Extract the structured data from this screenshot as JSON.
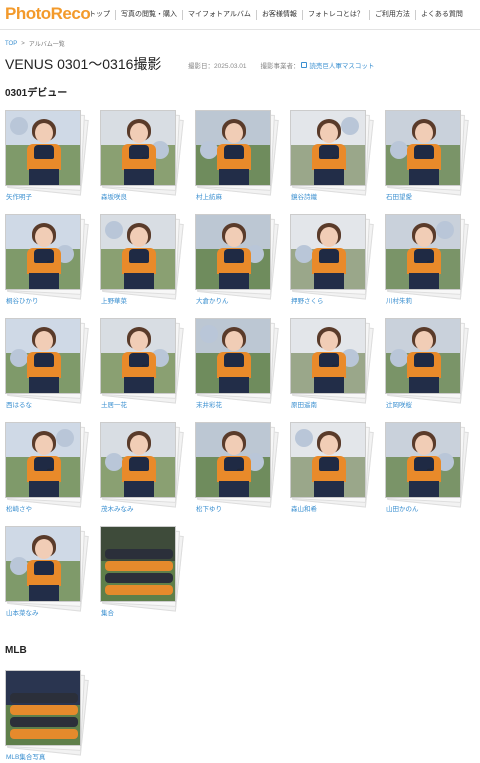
{
  "header": {
    "logo": "PhotoReco",
    "nav": [
      "トップ",
      "写真の閲覧・購入",
      "マイフォトアルバム",
      "お客様情報",
      "フォトレコとは？",
      "ご利用方法",
      "よくある質問"
    ]
  },
  "breadcrumb": {
    "home": "TOP",
    "separator": ">",
    "current": "アルバム一覧"
  },
  "page": {
    "title": "VENUS 0301～0316撮影",
    "date": "撮影日：2025.03.01",
    "seller_label": "撮影事業者：",
    "seller": "読売巨人軍マスコット"
  },
  "sections": [
    {
      "title": "0301デビュー",
      "albums": [
        "矢作明子",
        "森坂咲良",
        "村上紡麻",
        "鏡谷詩織",
        "石田望愛",
        "桐谷ひかり",
        "上野華菜",
        "大倉かりん",
        "押野さくら",
        "川村朱莉",
        "西はるな",
        "土居一花",
        "末井彩花",
        "原田遥南",
        "辻岡咲桜",
        "松崎さや",
        "茂木みなみ",
        "松下ゆり",
        "森山和希",
        "山田かのん",
        "山本菜なみ",
        "集合"
      ]
    },
    {
      "title": "MLB",
      "albums": [
        "MLB集合写真"
      ]
    }
  ],
  "colors": {
    "brand": "#f39a2b",
    "link": "#3a8fd0"
  }
}
